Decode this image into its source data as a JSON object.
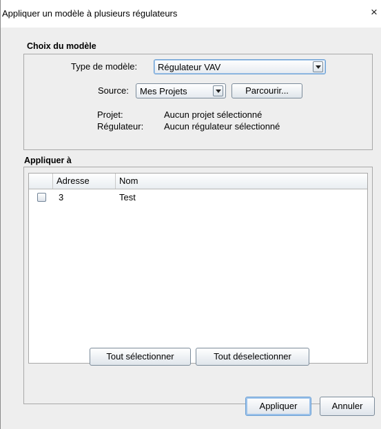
{
  "window": {
    "title": "Appliquer un modèle à plusieurs régulateurs",
    "close_glyph": "×"
  },
  "model_section": {
    "title": "Choix du modèle",
    "type_label": "Type de modèle:",
    "type_value": "Régulateur VAV",
    "source_label": "Source:",
    "source_value": "Mes Projets",
    "browse_label": "Parcourir...",
    "project_label": "Projet:",
    "project_value": "Aucun projet sélectionné",
    "controller_label": "Régulateur:",
    "controller_value": "Aucun régulateur sélectionné"
  },
  "apply_section": {
    "title": "Appliquer à",
    "columns": [
      "",
      "Adresse",
      "Nom"
    ],
    "rows": [
      {
        "checked": false,
        "address": "3",
        "name": "Test"
      }
    ],
    "select_all_label": "Tout sélectionner",
    "deselect_all_label": "Tout déselectionner"
  },
  "footer": {
    "apply_label": "Appliquer",
    "cancel_label": "Annuler"
  },
  "icons": {
    "close": "close-icon",
    "dropdown": "chevron-down-icon",
    "checkbox": "checkbox-icon"
  },
  "colors": {
    "window_bg": "#eeeeee",
    "focus_border": "#6a9fd4",
    "table_bg": "#ffffff"
  }
}
